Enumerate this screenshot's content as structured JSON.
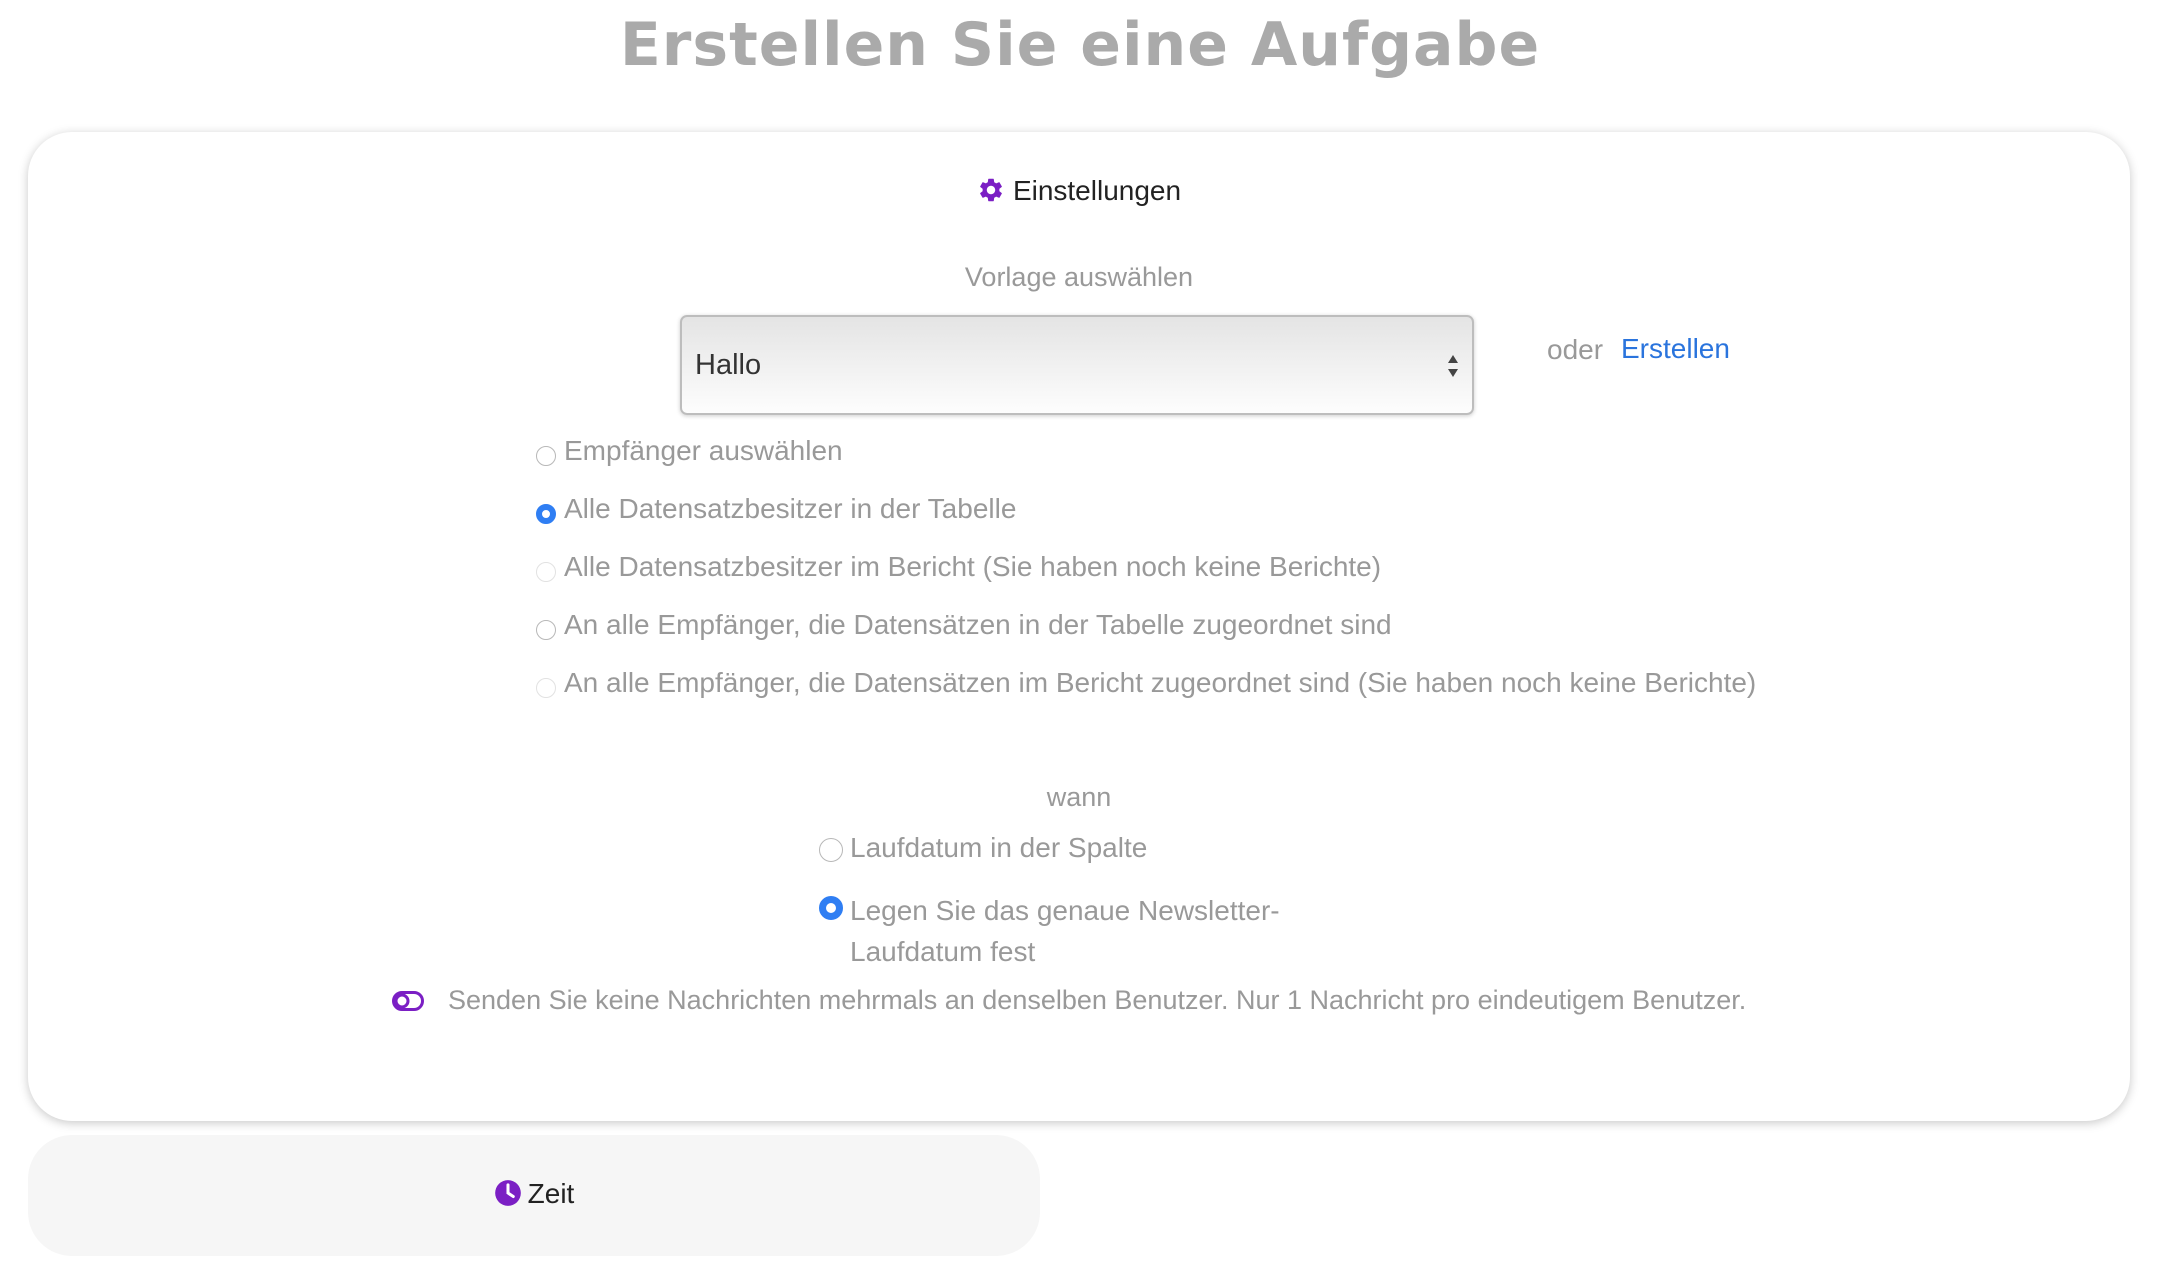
{
  "page": {
    "title": "Erstellen Sie eine Aufgabe"
  },
  "settings": {
    "heading": "Einstellungen",
    "heading_icon": "gear-icon",
    "icon_color": "#7b1fc4",
    "template_label": "Vorlage auswählen",
    "template_select": {
      "value": "Hallo"
    },
    "or_text": "oder",
    "create_link": "Erstellen",
    "link_color": "#2a74dd",
    "recipients": [
      {
        "label": "Empfänger auswählen",
        "checked": false,
        "disabled": false
      },
      {
        "label": "Alle Datensatzbesitzer in der Tabelle",
        "checked": true,
        "disabled": false
      },
      {
        "label": "Alle Datensatzbesitzer im Bericht (Sie haben noch keine Berichte)",
        "checked": false,
        "disabled": true
      },
      {
        "label": "An alle Empfänger, die Datensätzen in der Tabelle zugeordnet sind",
        "checked": false,
        "disabled": false
      },
      {
        "label": "An alle Empfänger, die Datensätzen im Bericht zugeordnet sind (Sie haben noch keine Berichte)",
        "checked": false,
        "disabled": true
      }
    ],
    "when_label": "wann",
    "when_options": [
      {
        "label": "Laufdatum in der Spalte",
        "checked": false
      },
      {
        "label": "Legen Sie das genaue Newsletter-\nLaufdatum fest",
        "line1": "Legen Sie das genaue Newsletter-",
        "line2": "Laufdatum fest",
        "checked": true
      }
    ],
    "unique_toggle": {
      "label": "Senden Sie keine Nachrichten mehrmals an denselben Benutzer. Nur 1 Nachricht pro eindeutigem Benutzer.",
      "icon": "toggle-off-icon"
    }
  },
  "time": {
    "heading": "Zeit",
    "heading_icon": "clock-icon"
  },
  "colors": {
    "radio_checked": "#2f7ef3",
    "accent_purple": "#7b1fc4"
  }
}
